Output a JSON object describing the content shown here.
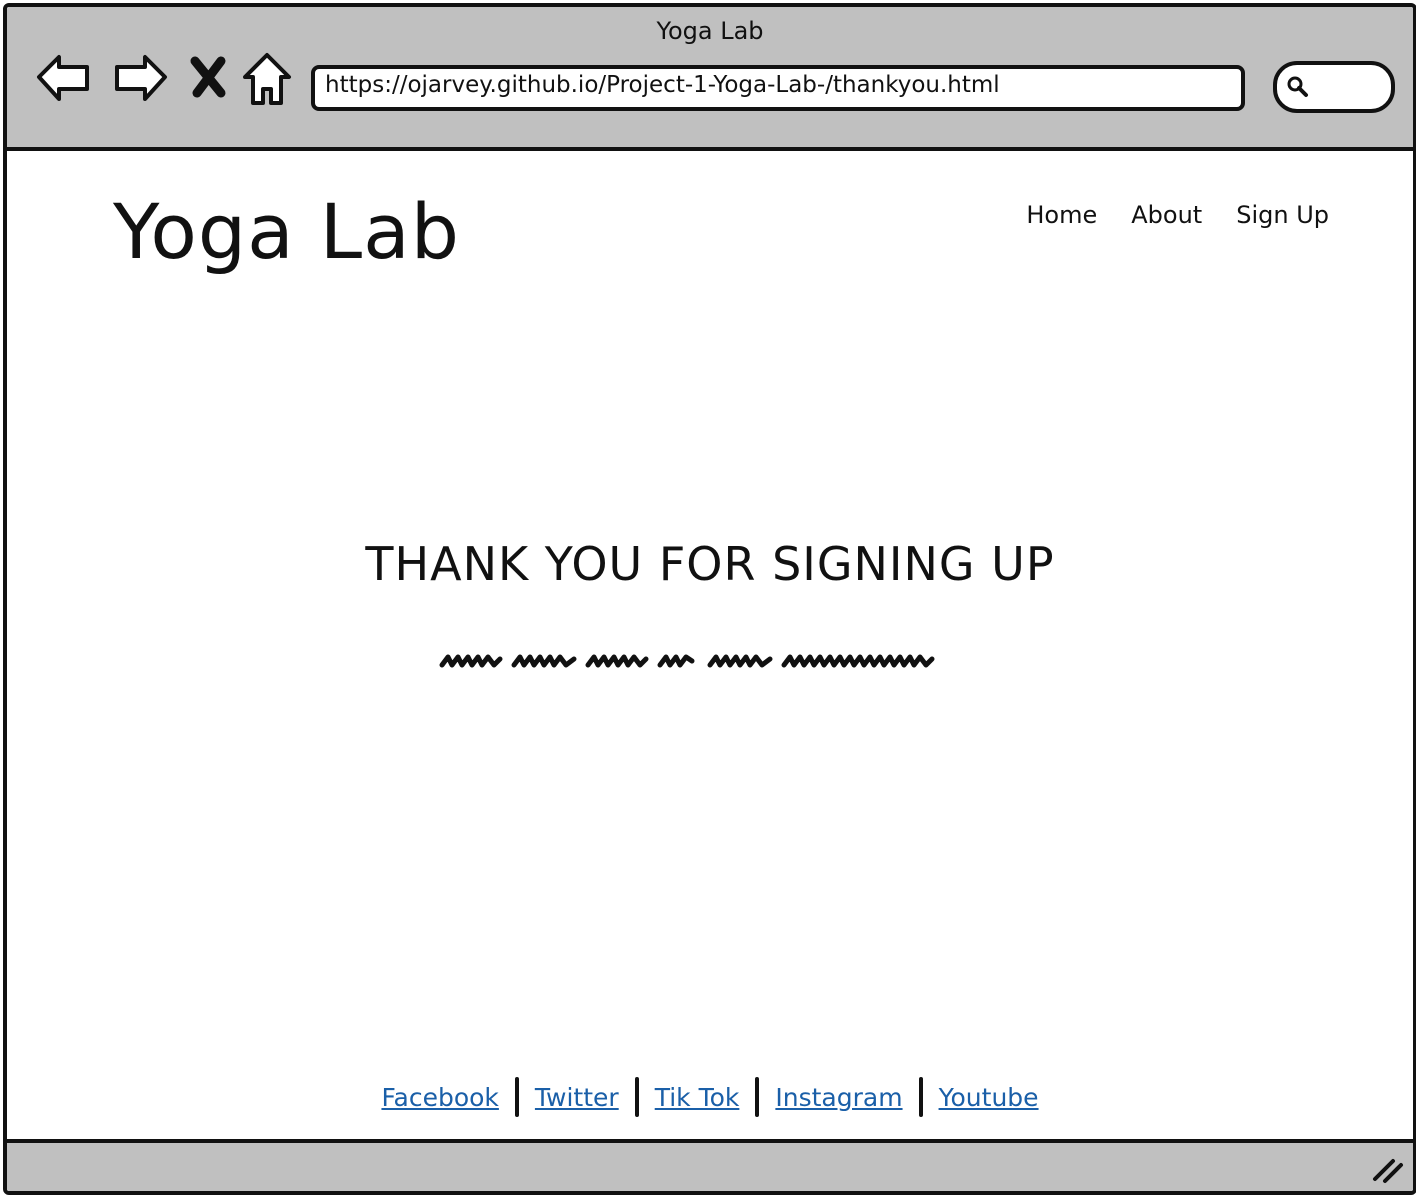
{
  "window": {
    "title": "Yoga Lab"
  },
  "browser": {
    "url": "https://ojarvey.github.io/Project-1-Yoga-Lab-/thankyou.html",
    "nav_icons": [
      "back-arrow-icon",
      "forward-arrow-icon",
      "close-icon",
      "home-icon"
    ],
    "search_icon": "search-icon"
  },
  "site": {
    "title": "Yoga Lab",
    "nav": [
      "Home",
      "About",
      "Sign Up"
    ]
  },
  "main": {
    "heading": "THANK YOU FOR SIGNING UP"
  },
  "footer": {
    "links": [
      "Facebook",
      "Twitter",
      "Tik Tok",
      "Instagram",
      "Youtube"
    ],
    "link_color": "#1a5fa8"
  },
  "colors": {
    "chrome": "#c0c0c0",
    "border": "#111111"
  }
}
